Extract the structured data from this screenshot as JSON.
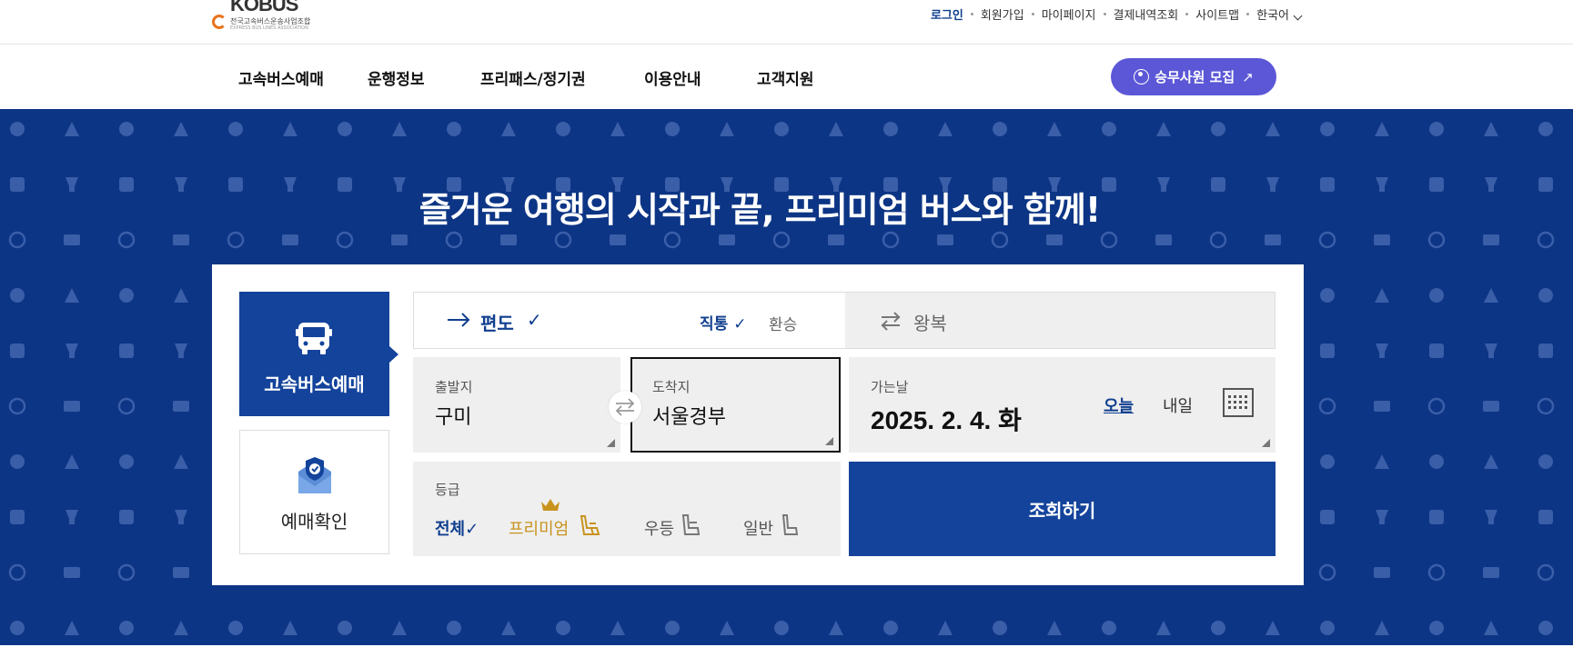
{
  "header": {
    "logo": {
      "brand": "KOBUS",
      "subtitle": "전국고속버스운송사업조합",
      "subtitle_en": "EXPRESS BUS LINES ASSOCIATION"
    },
    "utility_nav": [
      {
        "label": "로그인",
        "active": true
      },
      {
        "label": "회원가입",
        "active": false
      },
      {
        "label": "마이페이지",
        "active": false
      },
      {
        "label": "결제내역조회",
        "active": false
      },
      {
        "label": "사이트맵",
        "active": false
      }
    ],
    "language": "한국어"
  },
  "main_nav": {
    "items": [
      "고속버스예매",
      "운행정보",
      "프리패스/정기권",
      "이용안내",
      "고객지원"
    ],
    "recruit_button": "승무사원 모집",
    "recruit_arrow": "↗"
  },
  "hero": {
    "headline": "즐거운 여행의 시작과 끝, 프리미엄 버스와 함께!"
  },
  "booking": {
    "side_tabs": {
      "booking": "고속버스예매",
      "reservation_check": "예매확인"
    },
    "trip_type": {
      "one_way": "편도",
      "one_way_check": "✓",
      "direct": "직통",
      "direct_check": "✓",
      "transfer": "환승",
      "round_trip": "왕복"
    },
    "departure": {
      "caption": "출발지",
      "value": "구미"
    },
    "arrival": {
      "caption": "도착지",
      "value": "서울경부"
    },
    "date": {
      "caption": "가는날",
      "value": "2025. 2. 4. 화",
      "today": "오늘",
      "tomorrow": "내일"
    },
    "grade": {
      "caption": "등급",
      "options": [
        "전체",
        "프리미엄",
        "우등",
        "일반"
      ],
      "selected_check": "✓"
    },
    "search_button": "조회하기"
  },
  "colors": {
    "primary": "#13439b",
    "hero_bg": "#0d3585",
    "recruit": "#5b57d6",
    "premium": "#c8931d"
  }
}
